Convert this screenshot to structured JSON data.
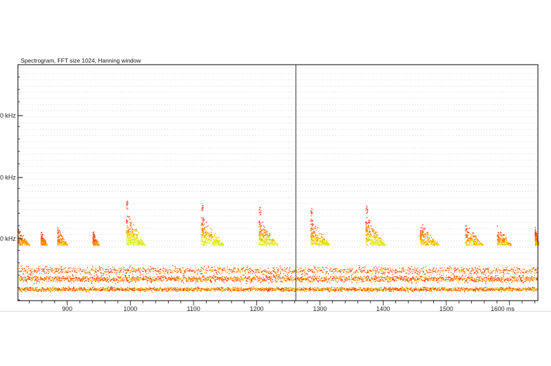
{
  "chart_data": {
    "type": "heatmap",
    "title": "Spectrogram, FFT size 1024, Hanning window",
    "x_unit": "ms",
    "x_range": [
      822,
      1645
    ],
    "x_ticks": [
      900,
      1000,
      1100,
      1200,
      1300,
      1400,
      1500,
      1600
    ],
    "x_tick_labels": [
      "900",
      "1000",
      "1100",
      "1200",
      "1300",
      "1400",
      "1500",
      "1600 ms"
    ],
    "y_major_ticks": [
      {
        "label": "0 kHz"
      },
      {
        "label": "0 kHz"
      },
      {
        "label": "0 kHz"
      }
    ],
    "grid": true,
    "cursor_ms": 1262,
    "colormap": [
      "#ff2a00",
      "#ff7800",
      "#ffd000",
      "#c8ff30"
    ],
    "noise_band_center_ms_range": [
      822,
      1645
    ],
    "calls": [
      {
        "t_ms": 822,
        "dur_ms": 18,
        "level": 0.35
      },
      {
        "t_ms": 858,
        "dur_ms": 10,
        "level": 0.25
      },
      {
        "t_ms": 884,
        "dur_ms": 16,
        "level": 0.4
      },
      {
        "t_ms": 940,
        "dur_ms": 10,
        "level": 0.25
      },
      {
        "t_ms": 993,
        "dur_ms": 30,
        "level": 1.0
      },
      {
        "t_ms": 1112,
        "dur_ms": 35,
        "level": 0.95
      },
      {
        "t_ms": 1203,
        "dur_ms": 30,
        "level": 0.8
      },
      {
        "t_ms": 1285,
        "dur_ms": 30,
        "level": 0.75
      },
      {
        "t_ms": 1372,
        "dur_ms": 32,
        "level": 0.85
      },
      {
        "t_ms": 1458,
        "dur_ms": 30,
        "level": 0.6
      },
      {
        "t_ms": 1530,
        "dur_ms": 28,
        "level": 0.55
      },
      {
        "t_ms": 1580,
        "dur_ms": 22,
        "level": 0.45
      },
      {
        "t_ms": 1640,
        "dur_ms": 6,
        "level": 0.4
      }
    ]
  }
}
